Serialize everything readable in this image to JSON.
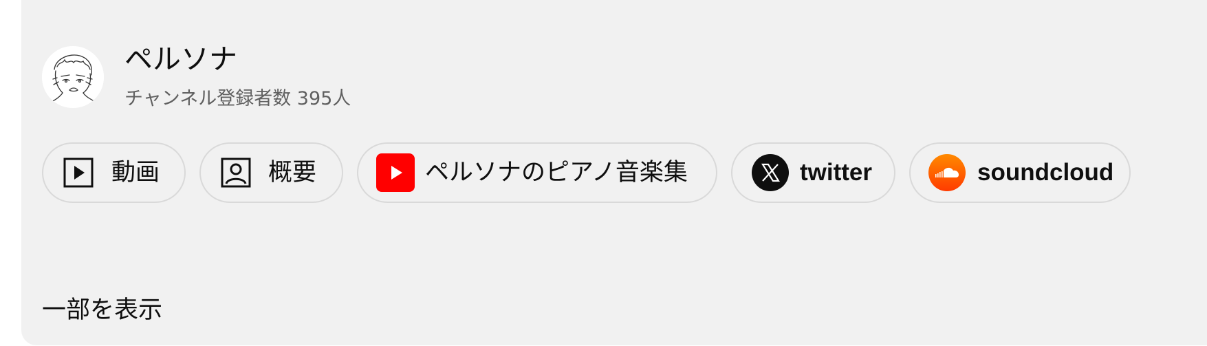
{
  "channel": {
    "name": "ペルソナ",
    "subscribers": "チャンネル登録者数 395人",
    "avatar_icon": "avatar-sketch-icon"
  },
  "links": [
    {
      "label": "動画",
      "icon": "play-video-icon"
    },
    {
      "label": "概要",
      "icon": "person-profile-icon"
    },
    {
      "label": "ペルソナのピアノ音楽集",
      "icon": "youtube-icon",
      "icon_color": "#ff0000"
    },
    {
      "label": "twitter",
      "icon": "x-logo-icon",
      "icon_color": "#0f0f0f"
    },
    {
      "label": "soundcloud",
      "icon": "soundcloud-icon",
      "icon_color": "#ff5500"
    }
  ],
  "show_more_label": "一部を表示"
}
